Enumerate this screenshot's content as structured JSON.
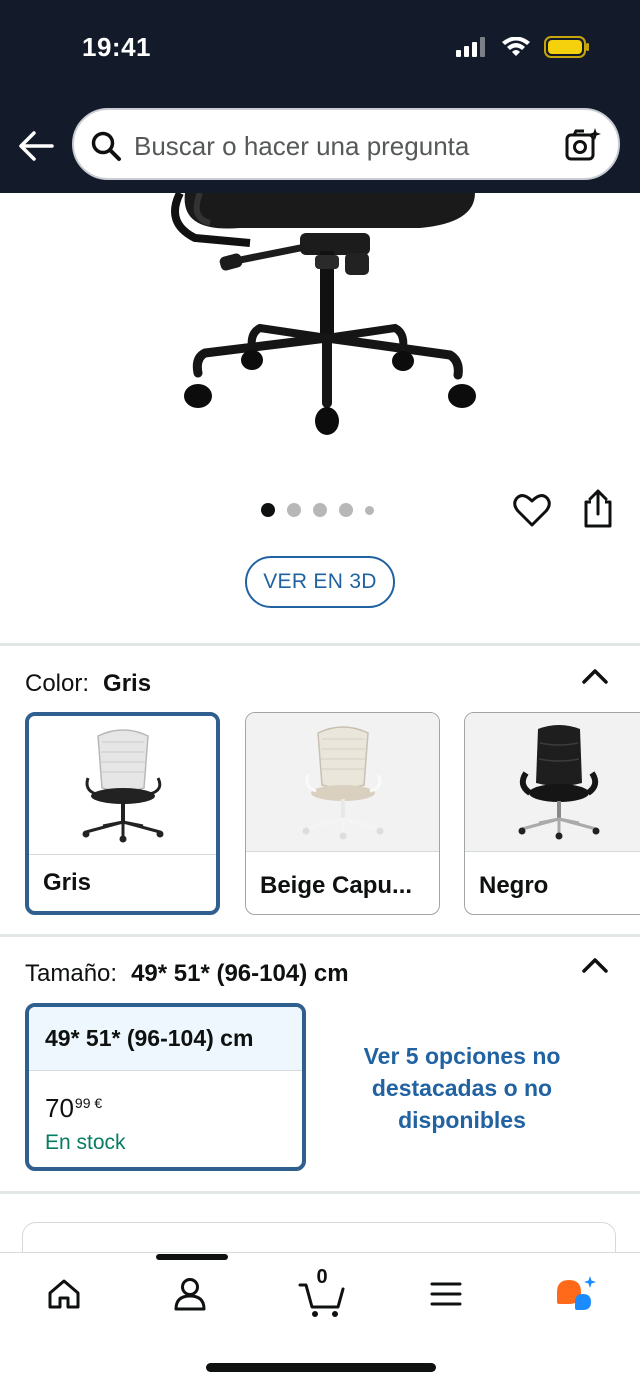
{
  "status_bar": {
    "time": "19:41"
  },
  "search": {
    "placeholder": "Buscar o hacer una pregunta"
  },
  "gallery": {
    "image_count": 5,
    "active_index": 0,
    "view_3d_label": "VER EN 3D"
  },
  "color_section": {
    "label": "Color:",
    "selected_value": "Gris",
    "options": [
      {
        "label": "Gris"
      },
      {
        "label": "Beige Capu..."
      },
      {
        "label": "Negro"
      }
    ]
  },
  "size_section": {
    "label": "Tamaño:",
    "selected_value": "49* 51* (96-104) cm",
    "card": {
      "size": "49* 51* (96-104) cm",
      "price_whole": "70",
      "price_fraction": "99 €",
      "availability": "En stock"
    },
    "more_options_text": "Ver 5 opciones no destacadas o no disponibles"
  },
  "bottom_nav": {
    "cart_count": "0",
    "items": [
      "home-icon",
      "account-icon",
      "cart-icon",
      "menu-icon",
      "assistant-icon"
    ]
  },
  "colors": {
    "header_bg": "#131a2a",
    "link_blue": "#2162a1",
    "selected_border": "#2f5f8f",
    "stock_green": "#067d62",
    "battery_yellow": "#f5d00d"
  }
}
